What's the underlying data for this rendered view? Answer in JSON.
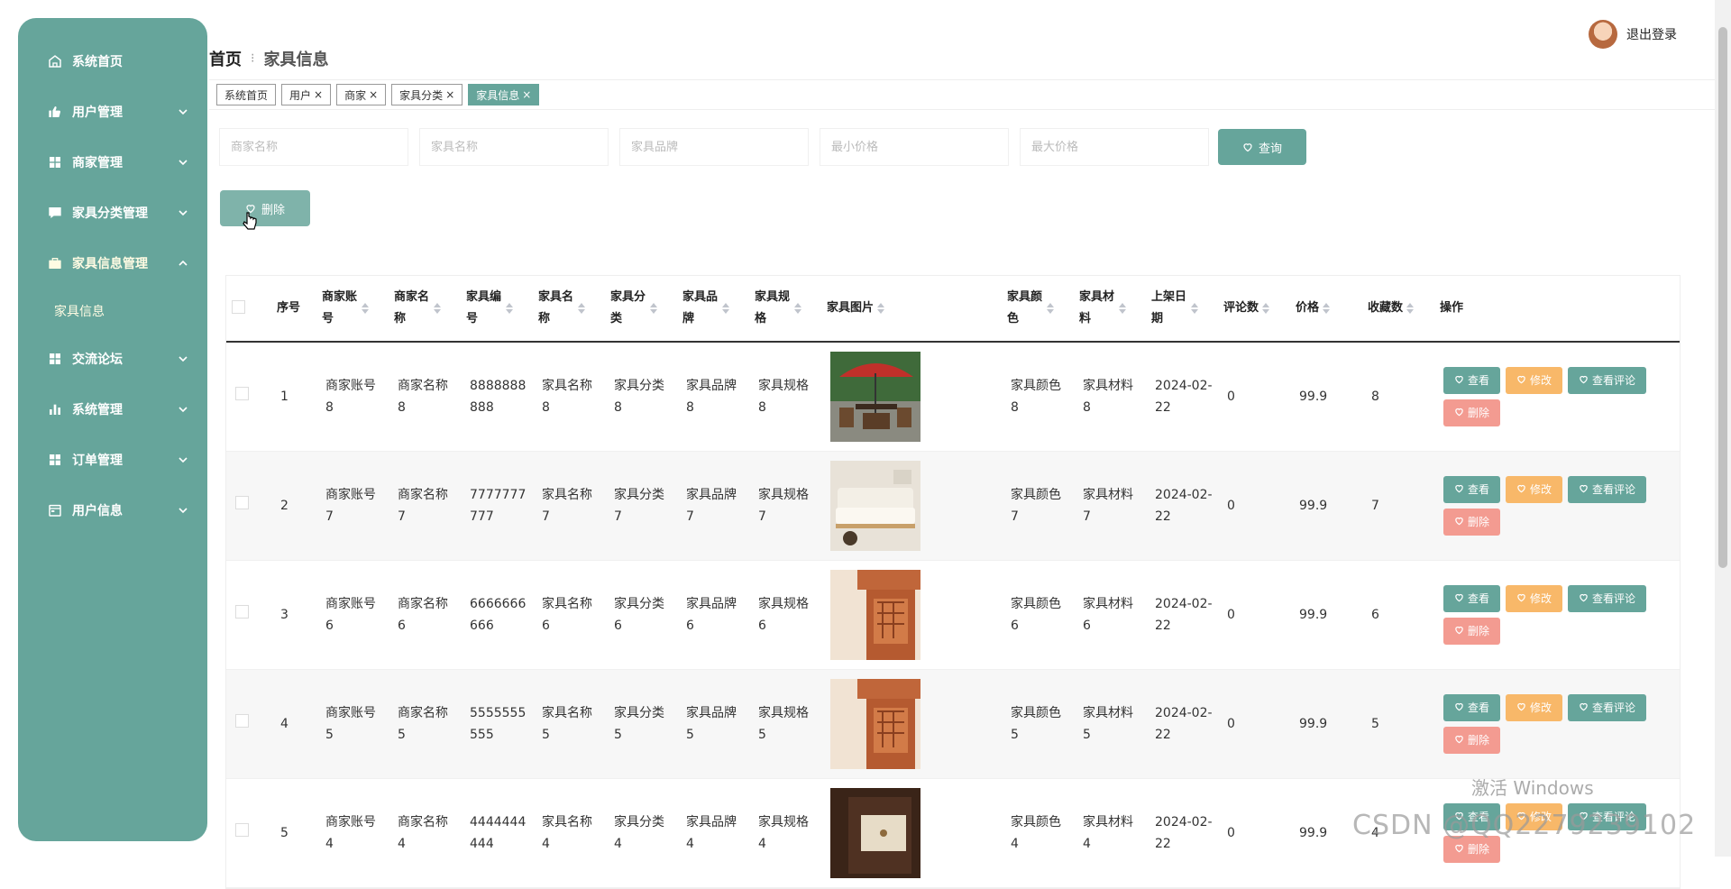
{
  "sidebar": {
    "items": [
      {
        "label": "系统首页",
        "icon": "home-icon",
        "has_arrow": false
      },
      {
        "label": "用户管理",
        "icon": "thumbs-up-icon",
        "has_arrow": true
      },
      {
        "label": "商家管理",
        "icon": "grid-icon",
        "has_arrow": true
      },
      {
        "label": "家具分类管理",
        "icon": "chat-icon",
        "has_arrow": true
      },
      {
        "label": "家具信息管理",
        "icon": "briefcase-icon",
        "has_arrow": true,
        "expanded": true,
        "active": true
      },
      {
        "label": "交流论坛",
        "icon": "grid-icon",
        "has_arrow": true
      },
      {
        "label": "系统管理",
        "icon": "bar-chart-icon",
        "has_arrow": true
      },
      {
        "label": "订单管理",
        "icon": "grid-icon",
        "has_arrow": true
      },
      {
        "label": "用户信息",
        "icon": "calendar-icon",
        "has_arrow": true
      }
    ],
    "subitem": "家具信息"
  },
  "header": {
    "breadcrumb_home": "首页",
    "breadcrumb_current": "家具信息",
    "logout": "退出登录"
  },
  "tags": [
    {
      "label": "系统首页",
      "closable": false,
      "active": false
    },
    {
      "label": "用户",
      "closable": true,
      "active": false
    },
    {
      "label": "商家",
      "closable": true,
      "active": false
    },
    {
      "label": "家具分类",
      "closable": true,
      "active": false
    },
    {
      "label": "家具信息",
      "closable": true,
      "active": true
    }
  ],
  "search": {
    "placeholders": [
      "商家名称",
      "家具名称",
      "家具品牌",
      "最小价格",
      "最大价格"
    ],
    "query_label": "查询",
    "delete_label": "删除"
  },
  "table": {
    "headers": [
      "序号",
      "商家账号",
      "商家名称",
      "家具编号",
      "家具名称",
      "家具分类",
      "家具品牌",
      "家具规格",
      "家具图片",
      "家具颜色",
      "家具材料",
      "上架日期",
      "评论数",
      "价格",
      "收藏数",
      "操作"
    ],
    "rows": [
      {
        "no": "1",
        "merchant_account": "商家账号8",
        "merchant_name": "商家名称8",
        "code": "8888888888",
        "name": "家具名称8",
        "category": "家具分类8",
        "brand": "家具品牌8",
        "spec": "家具规格8",
        "image": "outdoor-patio-umbrella",
        "color": "家具颜色8",
        "material": "家具材料8",
        "date": "2024-02-22",
        "comments": "0",
        "price": "99.9",
        "favorites": "8"
      },
      {
        "no": "2",
        "merchant_account": "商家账号7",
        "merchant_name": "商家名称7",
        "code": "7777777777",
        "name": "家具名称7",
        "category": "家具分类7",
        "brand": "家具品牌7",
        "spec": "家具规格7",
        "image": "sofa",
        "color": "家具颜色7",
        "material": "家具材料7",
        "date": "2024-02-22",
        "comments": "0",
        "price": "99.9",
        "favorites": "7"
      },
      {
        "no": "3",
        "merchant_account": "商家账号6",
        "merchant_name": "商家名称6",
        "code": "6666666666",
        "name": "家具名称6",
        "category": "家具分类6",
        "brand": "家具品牌6",
        "spec": "家具规格6",
        "image": "wooden-cabinet",
        "color": "家具颜色6",
        "material": "家具材料6",
        "date": "2024-02-22",
        "comments": "0",
        "price": "99.9",
        "favorites": "6"
      },
      {
        "no": "4",
        "merchant_account": "商家账号5",
        "merchant_name": "商家名称5",
        "code": "5555555555",
        "name": "家具名称5",
        "category": "家具分类5",
        "brand": "家具品牌5",
        "spec": "家具规格5",
        "image": "wooden-cabinet",
        "color": "家具颜色5",
        "material": "家具材料5",
        "date": "2024-02-22",
        "comments": "0",
        "price": "99.9",
        "favorites": "5"
      },
      {
        "no": "5",
        "merchant_account": "商家账号4",
        "merchant_name": "商家名称4",
        "code": "4444444444",
        "name": "家具名称4",
        "category": "家具分类4",
        "brand": "家具品牌4",
        "spec": "家具规格4",
        "image": "dark-drawer",
        "color": "家具颜色4",
        "material": "家具材料4",
        "date": "2024-02-22",
        "comments": "0",
        "price": "99.9",
        "favorites": "4"
      }
    ],
    "actions": {
      "view": "查看",
      "edit": "修改",
      "reviews": "查看评论",
      "delete": "删除"
    }
  },
  "watermark": {
    "line1": "激活 Windows",
    "line2": "CSDN @QQ2279239102"
  },
  "colors": {
    "primary": "#66a59b",
    "edit": "#f8b869",
    "delete": "#f39b91",
    "submenu": "#fffbe3"
  }
}
